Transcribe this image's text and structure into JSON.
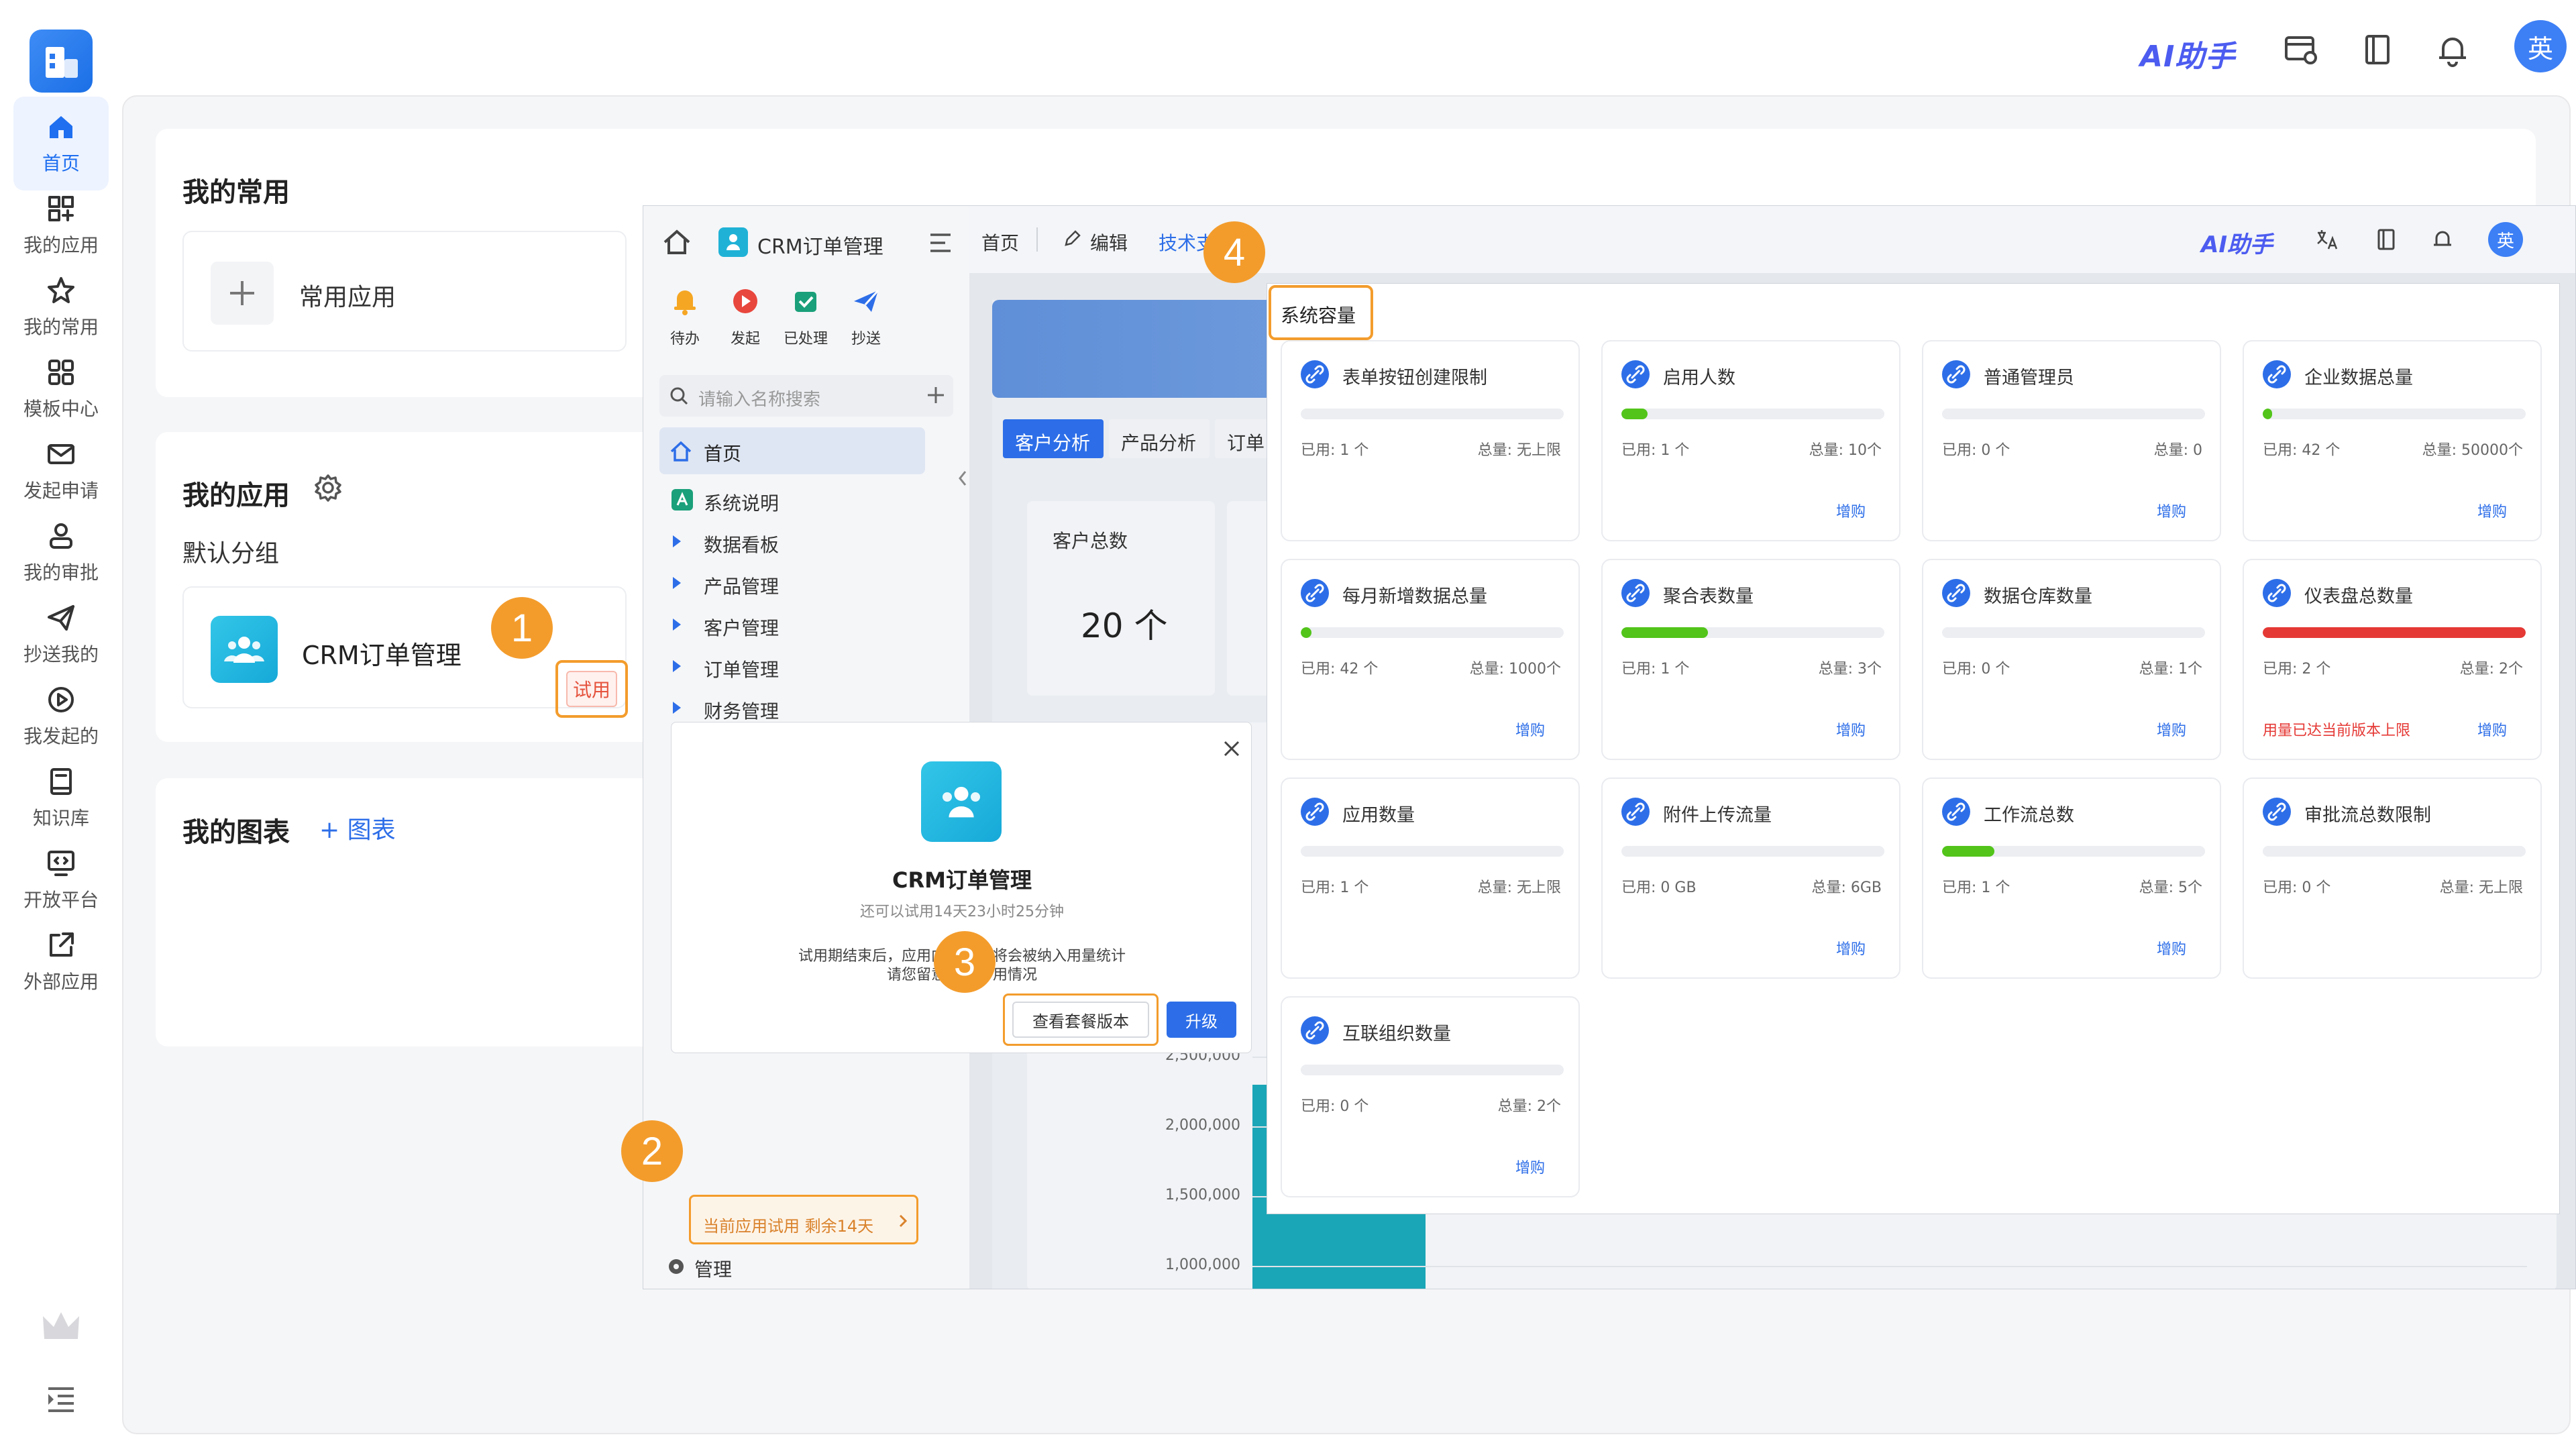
{
  "topbar": {
    "ai_label": "AI助手",
    "avatar": "英",
    "icons": [
      "window-settings-icon",
      "book-icon",
      "bell-icon"
    ]
  },
  "nav": [
    {
      "label": "首页",
      "icon": "home-icon",
      "active": true
    },
    {
      "label": "我的应用",
      "icon": "apps-add-icon"
    },
    {
      "label": "我的常用",
      "icon": "star-icon"
    },
    {
      "label": "模板中心",
      "icon": "grid-icon"
    },
    {
      "label": "发起申请",
      "icon": "mail-icon"
    },
    {
      "label": "我的审批",
      "icon": "user-check-icon"
    },
    {
      "label": "抄送我的",
      "icon": "send-icon"
    },
    {
      "label": "我发起的",
      "icon": "play-circle-icon"
    },
    {
      "label": "知识库",
      "icon": "book-icon"
    },
    {
      "label": "开放平台",
      "icon": "code-monitor-icon"
    },
    {
      "label": "外部应用",
      "icon": "external-link-icon"
    }
  ],
  "home": {
    "favorites_title": "我的常用",
    "favorites_add_label": "常用应用",
    "apps_title": "我的应用",
    "apps_group": "默认分组",
    "app_name": "CRM订单管理",
    "app_tag": "试用",
    "charts_title": "我的图表",
    "charts_add_label": "+ 图表"
  },
  "overlay": {
    "app_title": "CRM订单管理",
    "breadcrumb_home": "首页",
    "edit_label": "编辑",
    "tech_label": "技术支",
    "ai_label": "AI助手",
    "avatar": "英",
    "quick_actions": [
      "待办",
      "发起",
      "已处理",
      "抄送"
    ],
    "search_placeholder": "请输入名称搜索",
    "menu_home": "首页",
    "menu_items": [
      "系统说明",
      "数据看板",
      "产品管理",
      "客户管理",
      "订单管理",
      "财务管理"
    ],
    "tabs": [
      "客户分析",
      "产品分析",
      "订单"
    ],
    "stat_label": "客户总数",
    "stat_value": "20 个",
    "axis_labels": [
      "2,500,000",
      "2,000,000",
      "1,500,000",
      "1,000,000"
    ],
    "trial_text": "当前应用试用 剩余14天",
    "manage_label": "管理",
    "dialog": {
      "title": "CRM订单管理",
      "subtitle": "还可以试用14天23小时25分钟",
      "line1": "试用期结束后，应用内          将会被纳入用量统计",
      "line2": "请您留意          用情况",
      "view_plans": "查看套餐版本",
      "upgrade": "升级"
    }
  },
  "capacity": {
    "title": "系统容量",
    "buy_label": "增购",
    "items": [
      {
        "name": "表单按钮创建限制",
        "used": "已用:  1 个",
        "total": "总量:  无上限",
        "pct": 0,
        "color": "#52c41a",
        "buy": false
      },
      {
        "name": "启用人数",
        "used": "已用:  1 个",
        "total": "总量:  10个",
        "pct": 10,
        "color": "#52c41a",
        "buy": true
      },
      {
        "name": "普通管理员",
        "used": "已用:  0 个",
        "total": "总量:  0",
        "pct": 0,
        "color": "#52c41a",
        "buy": true
      },
      {
        "name": "企业数据总量",
        "used": "已用:  42 个",
        "total": "总量:  50000个",
        "pct": 0.5,
        "color": "#52c41a",
        "buy": true
      },
      {
        "name": "每月新增数据总量",
        "used": "已用:  42 个",
        "total": "总量:  1000个",
        "pct": 4.2,
        "color": "#52c41a",
        "buy": true
      },
      {
        "name": "聚合表数量",
        "used": "已用:  1 个",
        "total": "总量:  3个",
        "pct": 33,
        "color": "#52c41a",
        "buy": true
      },
      {
        "name": "数据仓库数量",
        "used": "已用:  0 个",
        "total": "总量:  1个",
        "pct": 0,
        "color": "#52c41a",
        "buy": true
      },
      {
        "name": "仪表盘总数量",
        "used": "已用:  2 个",
        "total": "总量:  2个",
        "pct": 100,
        "color": "#e53935",
        "buy": true,
        "warning": "用量已达当前版本上限"
      },
      {
        "name": "应用数量",
        "used": "已用:  1 个",
        "total": "总量:  无上限",
        "pct": 0,
        "color": "#52c41a",
        "buy": false
      },
      {
        "name": "附件上传流量",
        "used": "已用:  0 GB",
        "total": "总量:  6GB",
        "pct": 0,
        "color": "#52c41a",
        "buy": true
      },
      {
        "name": "工作流总数",
        "used": "已用:  1 个",
        "total": "总量:  5个",
        "pct": 20,
        "color": "#52c41a",
        "buy": true
      },
      {
        "name": "审批流总数限制",
        "used": "已用:  0 个",
        "total": "总量:  无上限",
        "pct": 0,
        "color": "#52c41a",
        "buy": false
      },
      {
        "name": "互联组织数量",
        "used": "已用:  0 个",
        "total": "总量:  2个",
        "pct": 0,
        "color": "#52c41a",
        "buy": true
      }
    ]
  },
  "callouts": [
    "1",
    "2",
    "3",
    "4"
  ]
}
